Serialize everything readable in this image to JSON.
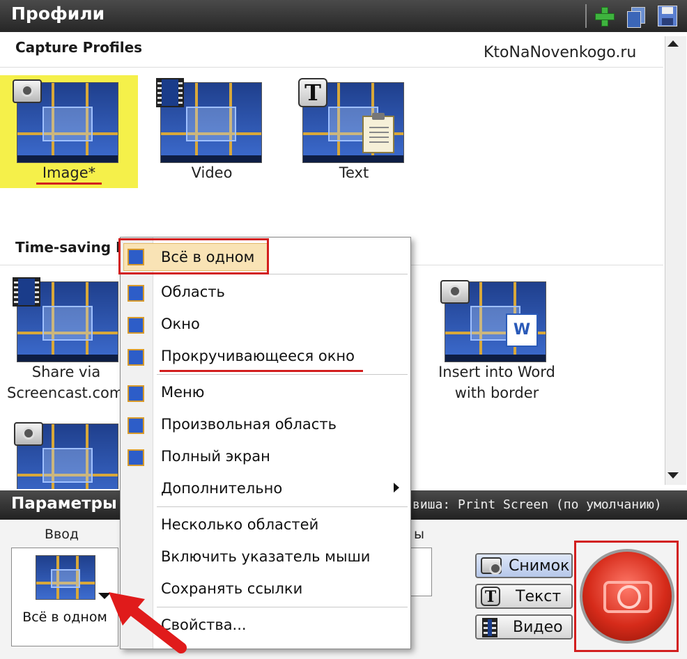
{
  "header": {
    "title": "Профили"
  },
  "watermark": "KtoNaNovenkogo.ru",
  "capture_profiles": {
    "section_title": "Capture Profiles",
    "items": [
      {
        "label": "Image*"
      },
      {
        "label": "Video"
      },
      {
        "label": "Text"
      }
    ]
  },
  "time_saving": {
    "section_title": "Time-saving P",
    "items": [
      {
        "label_line1": "Share via",
        "label_line2": "Screencast.com"
      },
      {
        "label_line1": "Insert into Word",
        "label_line2": "with border"
      }
    ]
  },
  "params": {
    "title": "Параметры",
    "hotkey_text": "вишa: Print Screen (по умолчанию)"
  },
  "input": {
    "label": "Ввод",
    "value": "Всё в одном",
    "other_label": "ы"
  },
  "mode_buttons": [
    {
      "label": "Снимок"
    },
    {
      "label": "Текст"
    },
    {
      "label": "Видео"
    }
  ],
  "menu": {
    "items": [
      {
        "label": "Всё в одном"
      },
      {
        "label": "Область"
      },
      {
        "label": "Окно"
      },
      {
        "label": "Прокручивающееся окно"
      },
      {
        "label": "Меню"
      },
      {
        "label": "Произвольная область"
      },
      {
        "label": "Полный экран"
      },
      {
        "label": "Дополнительно"
      },
      {
        "label": "Несколько областей"
      },
      {
        "label": "Включить указатель мыши"
      },
      {
        "label": "Сохранять ссылки"
      },
      {
        "label": "Свойства..."
      }
    ]
  },
  "colors": {
    "accent_red": "#d21e1e",
    "selected_tile": "#f5f04a",
    "header_bg": "#2f2f2f"
  }
}
